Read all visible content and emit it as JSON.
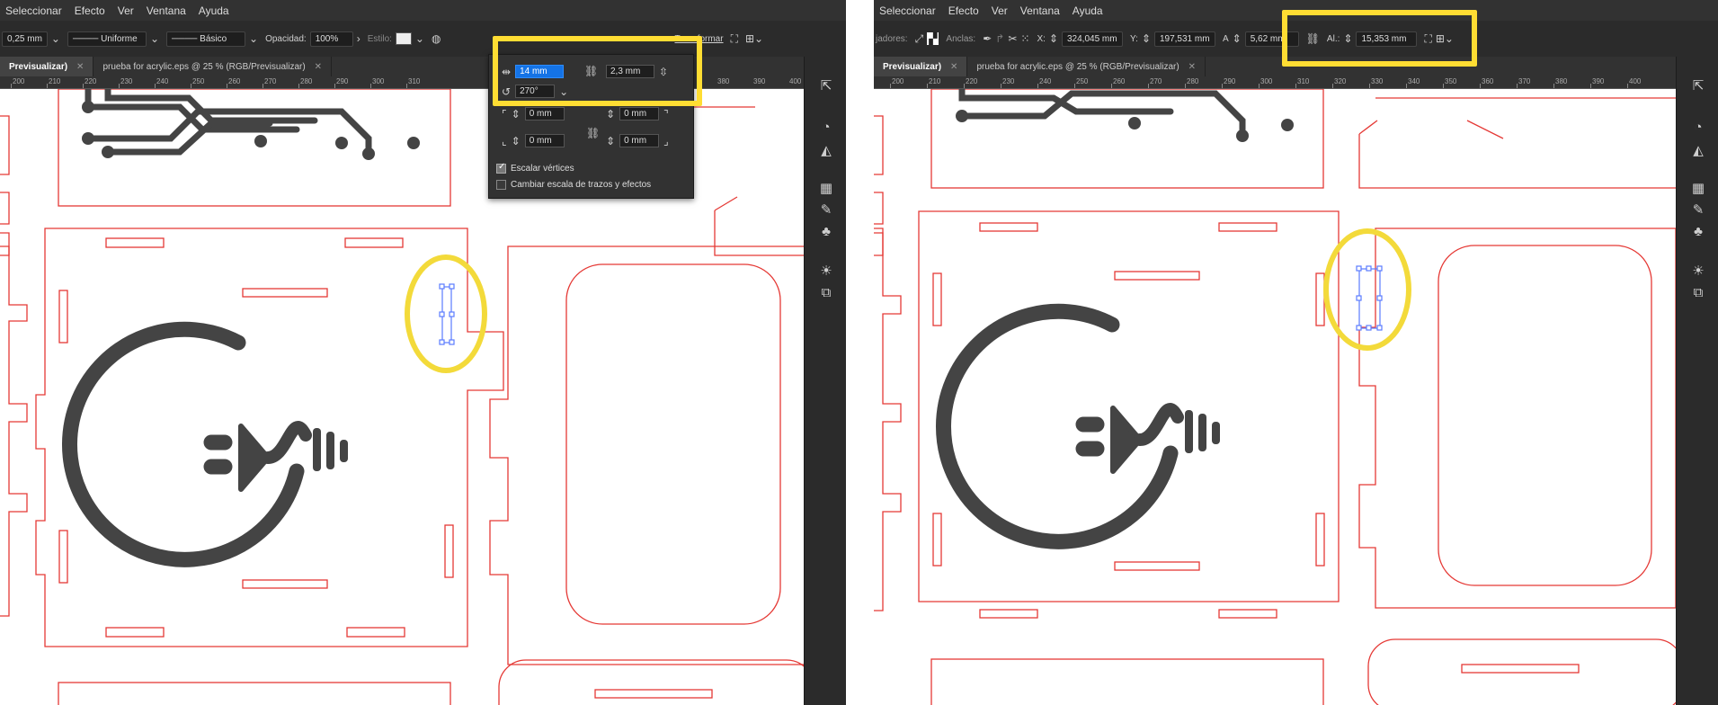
{
  "left": {
    "menu": [
      "Seleccionar",
      "Efecto",
      "Ver",
      "Ventana",
      "Ayuda"
    ],
    "control": {
      "stroke_weight": "0,25 mm",
      "profile": "Uniforme",
      "brush": "Básico",
      "opacity_label": "Opacidad:",
      "opacity_value": "100%",
      "style_label": "Estilo:",
      "transform_label": "Transformar"
    },
    "tabs": [
      {
        "label": "Previsualizar)",
        "active": true
      },
      {
        "label": "prueba for acrylic.eps @ 25 % (RGB/Previsualizar)",
        "active": false
      }
    ],
    "ruler": [
      "200",
      "210",
      "220",
      "230",
      "240",
      "250",
      "260",
      "270",
      "280",
      "290",
      "300",
      "310",
      "380",
      "390",
      "400"
    ],
    "popup": {
      "width": "14 mm",
      "height": "2,3 mm",
      "rotation": "270°",
      "corner_tl": "0 mm",
      "corner_tr": "0 mm",
      "corner_bl": "0 mm",
      "corner_br": "0 mm",
      "scale_corners_label": "Escalar vértices",
      "scale_corners_checked": true,
      "scale_strokes_label": "Cambiar escala de trazos y efectos",
      "scale_strokes_checked": false
    }
  },
  "right": {
    "menu": [
      "Seleccionar",
      "Efecto",
      "Ver",
      "Ventana",
      "Ayuda"
    ],
    "control": {
      "handles_label": "jadores:",
      "anchors_label": "Anclas:",
      "x_label": "X:",
      "x_value": "324,045 mm",
      "y_label": "Y:",
      "y_value": "197,531 mm",
      "w_label": "A",
      "w_value": "5,62 mm",
      "h_label": "Al.:",
      "h_value": "15,353 mm"
    },
    "tabs": [
      {
        "label": "Previsualizar)",
        "active": true
      },
      {
        "label": "prueba for acrylic.eps @ 25 % (RGB/Previsualizar)",
        "active": false
      }
    ],
    "ruler": [
      "200",
      "210",
      "220",
      "230",
      "240",
      "250",
      "260",
      "270",
      "280",
      "290",
      "300",
      "310",
      "320",
      "330",
      "340",
      "350",
      "360",
      "370",
      "380",
      "390",
      "400"
    ]
  },
  "colors": {
    "cut_line": "#e53935",
    "highlight": "#ffdd33",
    "logo": "#444444",
    "selection": "#5b7bff",
    "ui_dark": "#2b2b2b"
  },
  "icons": [
    "link-icon",
    "rotate-icon",
    "checkbox-icon",
    "panel-icon"
  ]
}
